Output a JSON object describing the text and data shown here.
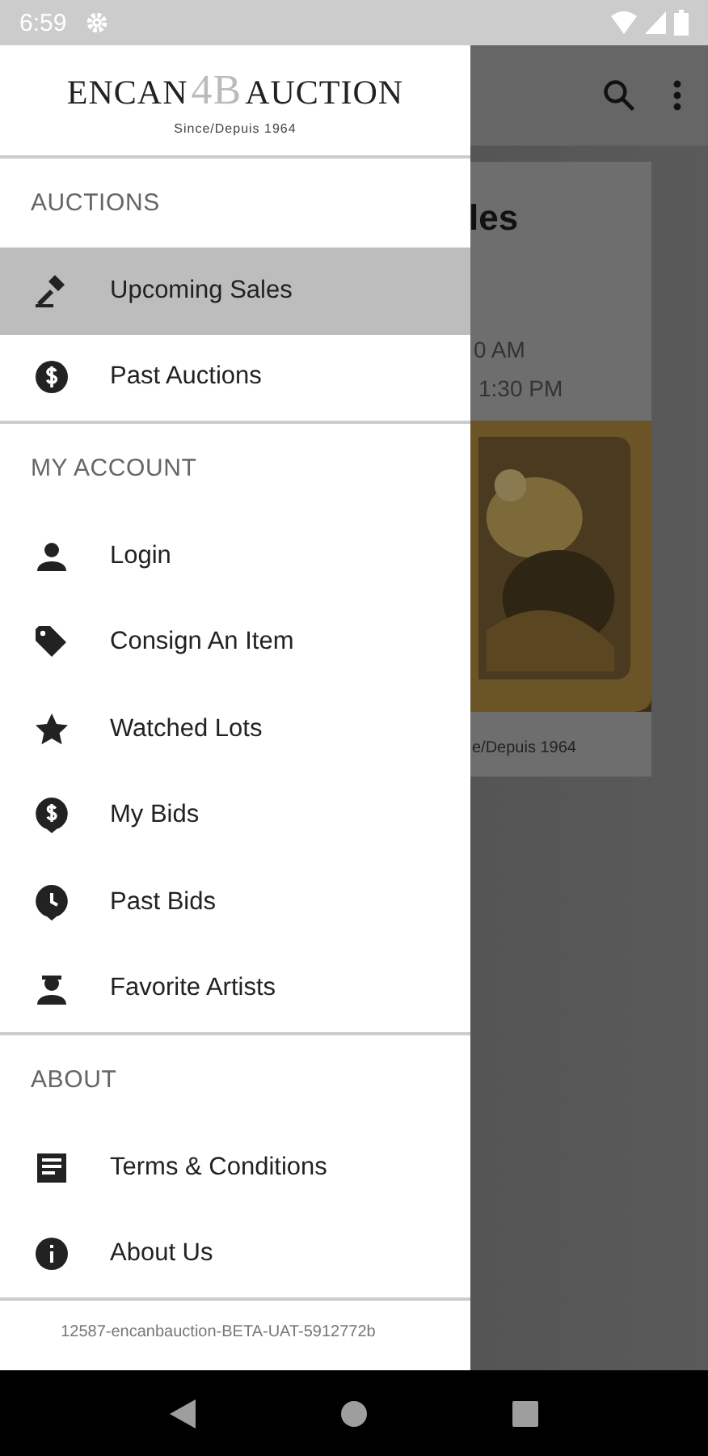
{
  "status_bar": {
    "time": "6:59"
  },
  "drawer": {
    "logo": {
      "left": "ENCAN",
      "mark": "4B",
      "right": "AUCTION",
      "tagline": "Since/Depuis 1964"
    },
    "sections": [
      {
        "title": "AUCTIONS",
        "items": [
          {
            "label": "Upcoming Sales",
            "selected": true
          },
          {
            "label": "Past Auctions",
            "selected": false
          }
        ]
      },
      {
        "title": "MY ACCOUNT",
        "items": [
          {
            "label": "Login",
            "selected": false
          },
          {
            "label": "Consign An Item",
            "selected": false
          },
          {
            "label": "Watched Lots",
            "selected": false
          },
          {
            "label": "My Bids",
            "selected": false
          },
          {
            "label": "Past Bids",
            "selected": false
          },
          {
            "label": "Favorite Artists",
            "selected": false
          }
        ]
      },
      {
        "title": "ABOUT",
        "items": [
          {
            "label": "Terms & Conditions",
            "selected": false
          },
          {
            "label": "About Us",
            "selected": false
          }
        ]
      }
    ],
    "version": "12587-encanbauction-BETA-UAT-5912772b"
  },
  "background": {
    "heading": "les",
    "line_1": "0 AM",
    "line_2": "1:30 PM",
    "tagline": "e/Depuis 1964"
  }
}
